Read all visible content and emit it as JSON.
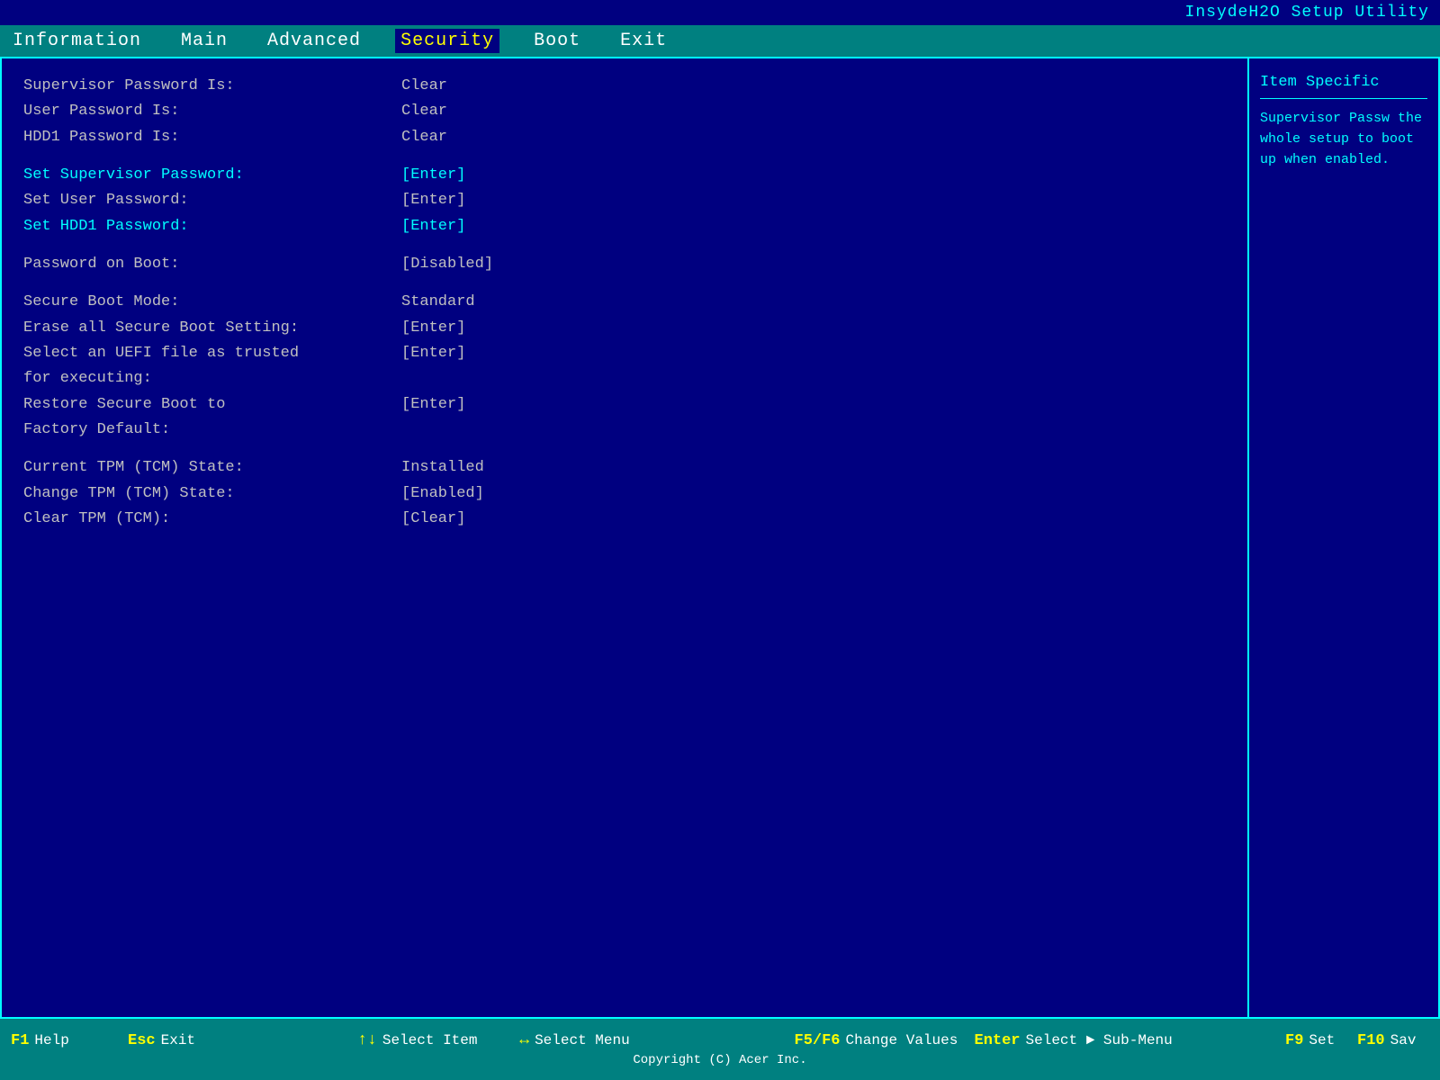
{
  "title_bar": {
    "text": "InsydeH2O Setup Utility"
  },
  "menu": {
    "items": [
      {
        "label": "Information",
        "active": false
      },
      {
        "label": "Main",
        "active": false
      },
      {
        "label": "Advanced",
        "active": false
      },
      {
        "label": "Security",
        "active": true
      },
      {
        "label": "Boot",
        "active": false
      },
      {
        "label": "Exit",
        "active": false
      }
    ]
  },
  "content": {
    "rows": [
      {
        "label": "Supervisor Password Is:",
        "value": "Clear",
        "highlight": false,
        "selected": false
      },
      {
        "label": "User Password Is:",
        "value": "Clear",
        "highlight": false,
        "selected": false
      },
      {
        "label": "HDD1 Password Is:",
        "value": "Clear",
        "highlight": false,
        "selected": false
      },
      {
        "spacer": true
      },
      {
        "label": "Set Supervisor Password:",
        "value": "[Enter]",
        "highlight": true,
        "selected": true
      },
      {
        "label": "Set User Password:",
        "value": "[Enter]",
        "highlight": false,
        "selected": false
      },
      {
        "label": "Set HDD1 Password:",
        "value": "[Enter]",
        "highlight": true,
        "selected": false
      },
      {
        "spacer": true
      },
      {
        "label": "Password on Boot:",
        "value": "[Disabled]",
        "highlight": false,
        "selected": false
      },
      {
        "spacer": true
      },
      {
        "label": "Secure Boot Mode:",
        "value": "Standard",
        "highlight": false,
        "selected": false
      },
      {
        "label": "Erase all Secure Boot Setting:",
        "value": "[Enter]",
        "highlight": false,
        "selected": false
      },
      {
        "label": "Select an UEFI file as trusted",
        "value": "[Enter]",
        "highlight": false,
        "selected": false
      },
      {
        "label": "for executing:",
        "value": "",
        "highlight": false,
        "selected": false
      },
      {
        "label": "Restore Secure Boot to",
        "value": "[Enter]",
        "highlight": false,
        "selected": false
      },
      {
        "label": "Factory Default:",
        "value": "",
        "highlight": false,
        "selected": false
      },
      {
        "spacer": true
      },
      {
        "label": "Current TPM (TCM) State:",
        "value": "Installed",
        "highlight": false,
        "selected": false
      },
      {
        "label": "Change TPM (TCM) State:",
        "value": "[Enabled]",
        "highlight": false,
        "selected": false
      },
      {
        "label": "Clear TPM (TCM):",
        "value": "[Clear]",
        "highlight": false,
        "selected": false
      }
    ]
  },
  "help_panel": {
    "title": "Item Specific",
    "text": "Supervisor Passw the whole setup to boot up when enabled."
  },
  "status_bar": {
    "f1_key": "F1",
    "f1_desc": "Help",
    "esc_key": "Esc",
    "esc_desc": "Exit",
    "arrow_updown": "↑↓",
    "select_item": "Select Item",
    "arrow_leftright": "↔",
    "select_menu": "Select Menu",
    "f5f6_key": "F5/F6",
    "f5f6_desc": "Change Values",
    "enter_key": "Enter",
    "enter_desc": "Select ► Sub-Menu",
    "f9_key": "F9",
    "f9_desc": "Set",
    "f10_key": "F10",
    "f10_desc": "Sav",
    "copyright": "Copyright (C) Acer Inc."
  }
}
